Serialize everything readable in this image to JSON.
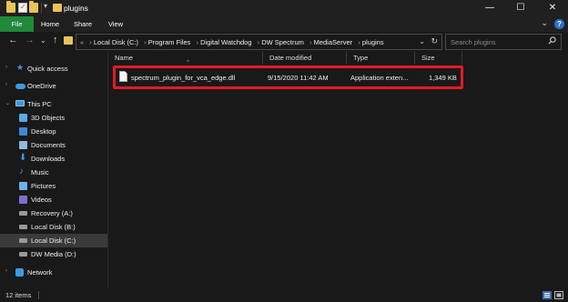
{
  "window": {
    "title": "plugins",
    "minimize_glyph": "—",
    "maximize_glyph": "☐",
    "close_glyph": "✕"
  },
  "quick_access_toolbar": {
    "icons": [
      "folder-icon",
      "properties-icon",
      "new-folder-icon"
    ],
    "dropdown_glyph": "▾"
  },
  "ribbon": {
    "tabs": [
      "File",
      "Home",
      "Share",
      "View"
    ],
    "expand_glyph": "⌄",
    "help_glyph": "?"
  },
  "navigation": {
    "back_glyph": "←",
    "forward_glyph": "→",
    "recent_glyph": "⌄",
    "up_glyph": "↑"
  },
  "address": {
    "overflow": "«",
    "crumbs": [
      "Local Disk (C:)",
      "Program Files",
      "Digital Watchdog",
      "DW Spectrum",
      "MediaServer",
      "plugins"
    ],
    "dropdown_glyph": "⌄",
    "refresh_glyph": "↻"
  },
  "search": {
    "placeholder": "Search plugins",
    "icon": "search-icon"
  },
  "sidebar": {
    "items": [
      {
        "label": "Quick access",
        "icon": "star-icon"
      },
      {
        "label": "OneDrive",
        "icon": "cloud-icon"
      },
      {
        "label": "This PC",
        "icon": "computer-icon"
      },
      {
        "label": "3D Objects",
        "icon": "cube-icon"
      },
      {
        "label": "Desktop",
        "icon": "desktop-icon"
      },
      {
        "label": "Documents",
        "icon": "documents-icon"
      },
      {
        "label": "Downloads",
        "icon": "download-icon"
      },
      {
        "label": "Music",
        "icon": "music-icon"
      },
      {
        "label": "Pictures",
        "icon": "pictures-icon"
      },
      {
        "label": "Videos",
        "icon": "videos-icon"
      },
      {
        "label": "Recovery (A:)",
        "icon": "drive-icon"
      },
      {
        "label": "Local Disk (B:)",
        "icon": "drive-icon"
      },
      {
        "label": "Local Disk (C:)",
        "icon": "drive-icon",
        "selected": true
      },
      {
        "label": "DW Media (D:)",
        "icon": "drive-icon"
      },
      {
        "label": "Network",
        "icon": "network-icon"
      }
    ]
  },
  "file_list": {
    "columns": [
      "Name",
      "Date modified",
      "Type",
      "Size"
    ],
    "sort_glyph": "^",
    "rows": [
      {
        "name": "spectrum_plugin_for_vca_edge.dll",
        "date_modified": "9/15/2020 11:42 AM",
        "type": "Application exten...",
        "size": "1,349 KB",
        "icon": "dll-file-icon"
      }
    ]
  },
  "status_bar": {
    "item_count": "12 items"
  },
  "colors": {
    "file_tab": "#1e8a3a",
    "highlight_border": "#e31b23",
    "background": "#191919",
    "folder": "#e8c35a",
    "accent_blue": "#3b9be0"
  }
}
